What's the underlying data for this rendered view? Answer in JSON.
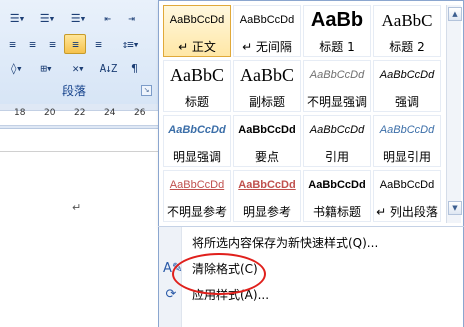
{
  "ribbon": {
    "group_label": "段落",
    "launcher_symbol": "↘",
    "buttons": [
      {
        "id": "bullets",
        "glyph": "☰▾"
      },
      {
        "id": "numbering",
        "glyph": "☰▾"
      },
      {
        "id": "multilevel",
        "glyph": "☰▾"
      },
      {
        "id": "decrease-indent",
        "glyph": "⇤"
      },
      {
        "id": "increase-indent",
        "glyph": "⇥"
      },
      {
        "id": "align-left",
        "glyph": "≡"
      },
      {
        "id": "center",
        "glyph": "≡"
      },
      {
        "id": "align-right",
        "glyph": "≡"
      },
      {
        "id": "justify",
        "glyph": "≡"
      },
      {
        "id": "distributed",
        "glyph": "≡"
      },
      {
        "id": "line-spacing",
        "glyph": "↕≡▾"
      },
      {
        "id": "shading",
        "glyph": "◊▾"
      },
      {
        "id": "borders",
        "glyph": "⊞▾"
      },
      {
        "id": "chinese-layout",
        "glyph": "✕▾"
      },
      {
        "id": "sort",
        "glyph": "A↓Z"
      },
      {
        "id": "show-marks",
        "glyph": "¶"
      }
    ]
  },
  "ruler": {
    "numbers": [
      "18",
      "20",
      "22",
      "24",
      "26"
    ]
  },
  "document": {
    "paragraph_mark": "↵"
  },
  "styles_gallery": {
    "styles": [
      {
        "sample": "AaBbCcDd",
        "name": "↵ 正文",
        "kind": "s-normal",
        "selected": true
      },
      {
        "sample": "AaBbCcDd",
        "name": "↵ 无间隔",
        "kind": "s-normal",
        "selected": false
      },
      {
        "sample": "AaBb",
        "name": "标题 1",
        "kind": "s-h1",
        "selected": false
      },
      {
        "sample": "AaBbC",
        "name": "标题 2",
        "kind": "s-h2",
        "selected": false
      },
      {
        "sample": "AaBbC",
        "name": "标题",
        "kind": "s-title",
        "selected": false
      },
      {
        "sample": "AaBbC",
        "name": "副标题",
        "kind": "s-sub",
        "selected": false
      },
      {
        "sample": "AaBbCcDd",
        "name": "不明显强调",
        "kind": "s-subtle",
        "selected": false
      },
      {
        "sample": "AaBbCcDd",
        "name": "强调",
        "kind": "s-emph",
        "selected": false
      },
      {
        "sample": "AaBbCcDd",
        "name": "明显强调",
        "kind": "s-intense",
        "selected": false
      },
      {
        "sample": "AaBbCcDd",
        "name": "要点",
        "kind": "s-strong",
        "selected": false
      },
      {
        "sample": "AaBbCcDd",
        "name": "引用",
        "kind": "s-quote",
        "selected": false
      },
      {
        "sample": "AaBbCcDd",
        "name": "明显引用",
        "kind": "s-intquote",
        "selected": false
      },
      {
        "sample": "AaBbCcDd",
        "name": "不明显参考",
        "kind": "s-subref",
        "selected": false
      },
      {
        "sample": "AaBbCcDd",
        "name": "明显参考",
        "kind": "s-intref",
        "selected": false
      },
      {
        "sample": "AaBbCcDd",
        "name": "书籍标题",
        "kind": "s-book",
        "selected": false
      },
      {
        "sample": "AaBbCcDd",
        "name": "↵ 列出段落",
        "kind": "s-list",
        "selected": false
      }
    ],
    "scroll_up_symbol": "▲",
    "scroll_down_symbol": "▼",
    "more_symbol": "▾"
  },
  "menu": {
    "items": [
      {
        "label": "将所选内容保存为新快速样式(Q)...",
        "icon": "",
        "icon_name": "none"
      },
      {
        "label": "清除格式(C)",
        "icon": "A✎",
        "icon_name": "clear-formatting-icon"
      },
      {
        "label": "应用样式(A)...",
        "icon": "⟳",
        "icon_name": "apply-styles-icon"
      }
    ]
  },
  "colors": {
    "highlight": "#e0201c",
    "selected_tile": "#ffe7a6",
    "ribbon_text": "#15428b"
  }
}
